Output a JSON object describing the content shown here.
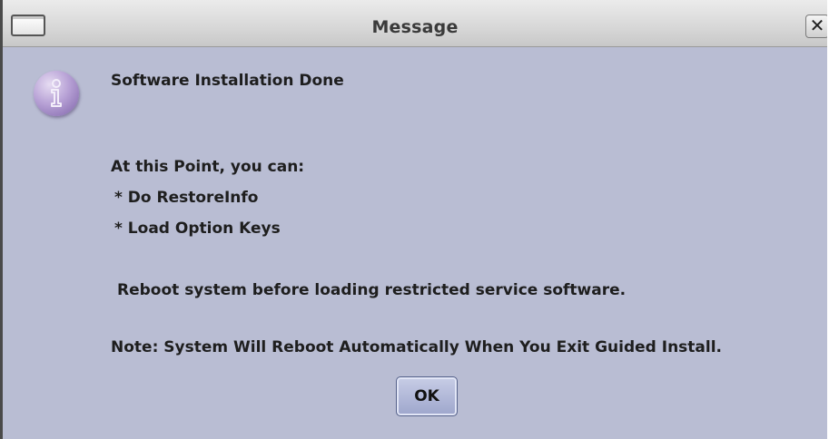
{
  "window": {
    "title": "Message",
    "close_glyph": "✕",
    "window_icon": "window-icon",
    "message_icon": "information-icon"
  },
  "message": {
    "heading": "Software Installation Done",
    "intro": "At this Point, you can:",
    "options": [
      "* Do RestoreInfo",
      "* Load Option Keys"
    ],
    "warning": "Reboot system before loading restricted service software.",
    "note": "Note: System Will Reboot Automatically When You Exit Guided Install."
  },
  "buttons": {
    "ok_label": "OK"
  },
  "colors": {
    "dialog_background": "#b9bdd3",
    "title_bar": "#d9d9d9",
    "info_icon": "#b8a2d6",
    "ok_button": "#9ea6cc"
  }
}
